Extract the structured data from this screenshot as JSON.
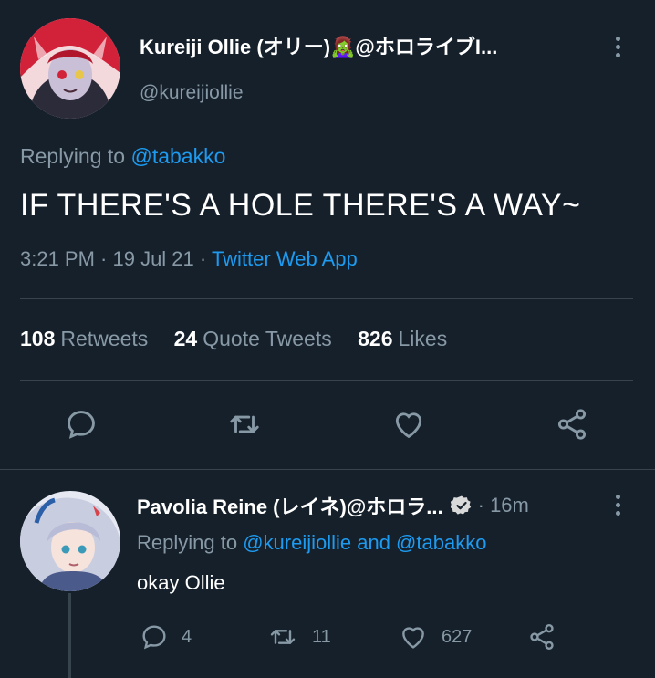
{
  "main_tweet": {
    "display_name": "Kureiji Ollie (オリー)🧟‍♀️@ホロライブI...",
    "handle": "@kureijiollie",
    "replying_prefix": "Replying to",
    "replying_to": "@tabakko",
    "text": "IF THERE'S A HOLE THERE'S A WAY~",
    "time": "3:21 PM · 19 Jul 21 ·",
    "source": "Twitter Web App",
    "stats": [
      {
        "count": "108",
        "label": "Retweets"
      },
      {
        "count": "24",
        "label": "Quote Tweets"
      },
      {
        "count": "826",
        "label": "Likes"
      }
    ],
    "actions": [
      "reply-icon",
      "retweet-icon",
      "like-icon",
      "share-icon"
    ]
  },
  "reply_tweet": {
    "display_name": "Pavolia Reine (レイネ)@ホロラ...",
    "verified_icon": "verified-badge-icon",
    "time": "· 16m",
    "replying_prefix": "Replying to",
    "replying_to": "@kureijiollie and @tabakko",
    "text": "okay Ollie",
    "counts": {
      "replies": "4",
      "retweets": "11",
      "likes": "627"
    }
  },
  "colors": {
    "background": "#15202b",
    "accent": "#1d9bf0",
    "secondary_text": "#8899a6",
    "divider": "#38444d"
  }
}
